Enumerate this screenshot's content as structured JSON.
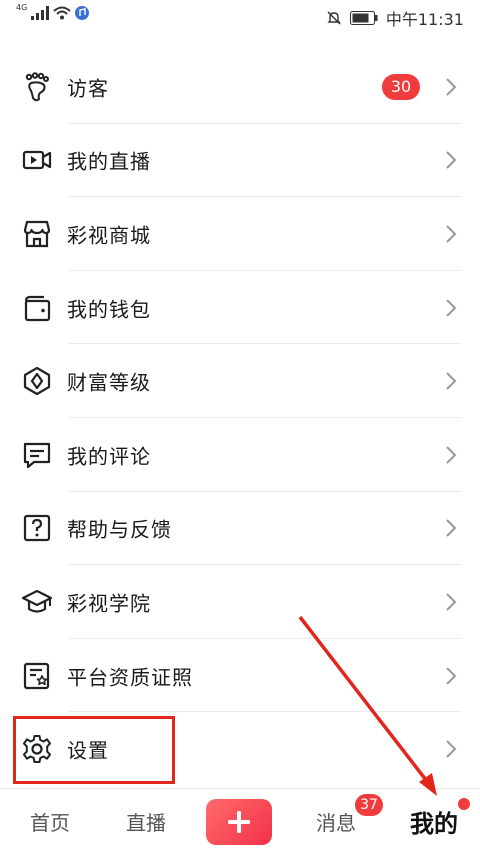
{
  "status_bar": {
    "network": "4G",
    "time": "中午11:31"
  },
  "menu": {
    "items": [
      {
        "label": "访客",
        "badge": "30",
        "icon": "footprint-icon"
      },
      {
        "label": "我的直播",
        "icon": "video-camera-icon"
      },
      {
        "label": "彩视商城",
        "icon": "storefront-icon"
      },
      {
        "label": "我的钱包",
        "icon": "wallet-icon"
      },
      {
        "label": "财富等级",
        "icon": "diamond-badge-icon"
      },
      {
        "label": "我的评论",
        "icon": "comment-icon"
      },
      {
        "label": "帮助与反馈",
        "icon": "question-icon"
      },
      {
        "label": "彩视学院",
        "icon": "graduation-cap-icon"
      },
      {
        "label": "平台资质证照",
        "icon": "certificate-icon"
      },
      {
        "label": "设置",
        "icon": "gear-icon"
      }
    ]
  },
  "tab_bar": {
    "home": "首页",
    "live": "直播",
    "create": "+",
    "messages": "消息",
    "messages_badge": "37",
    "mine": "我的"
  },
  "colors": {
    "accent_red": "#f03c3c",
    "highlight_red": "#e2261c"
  }
}
